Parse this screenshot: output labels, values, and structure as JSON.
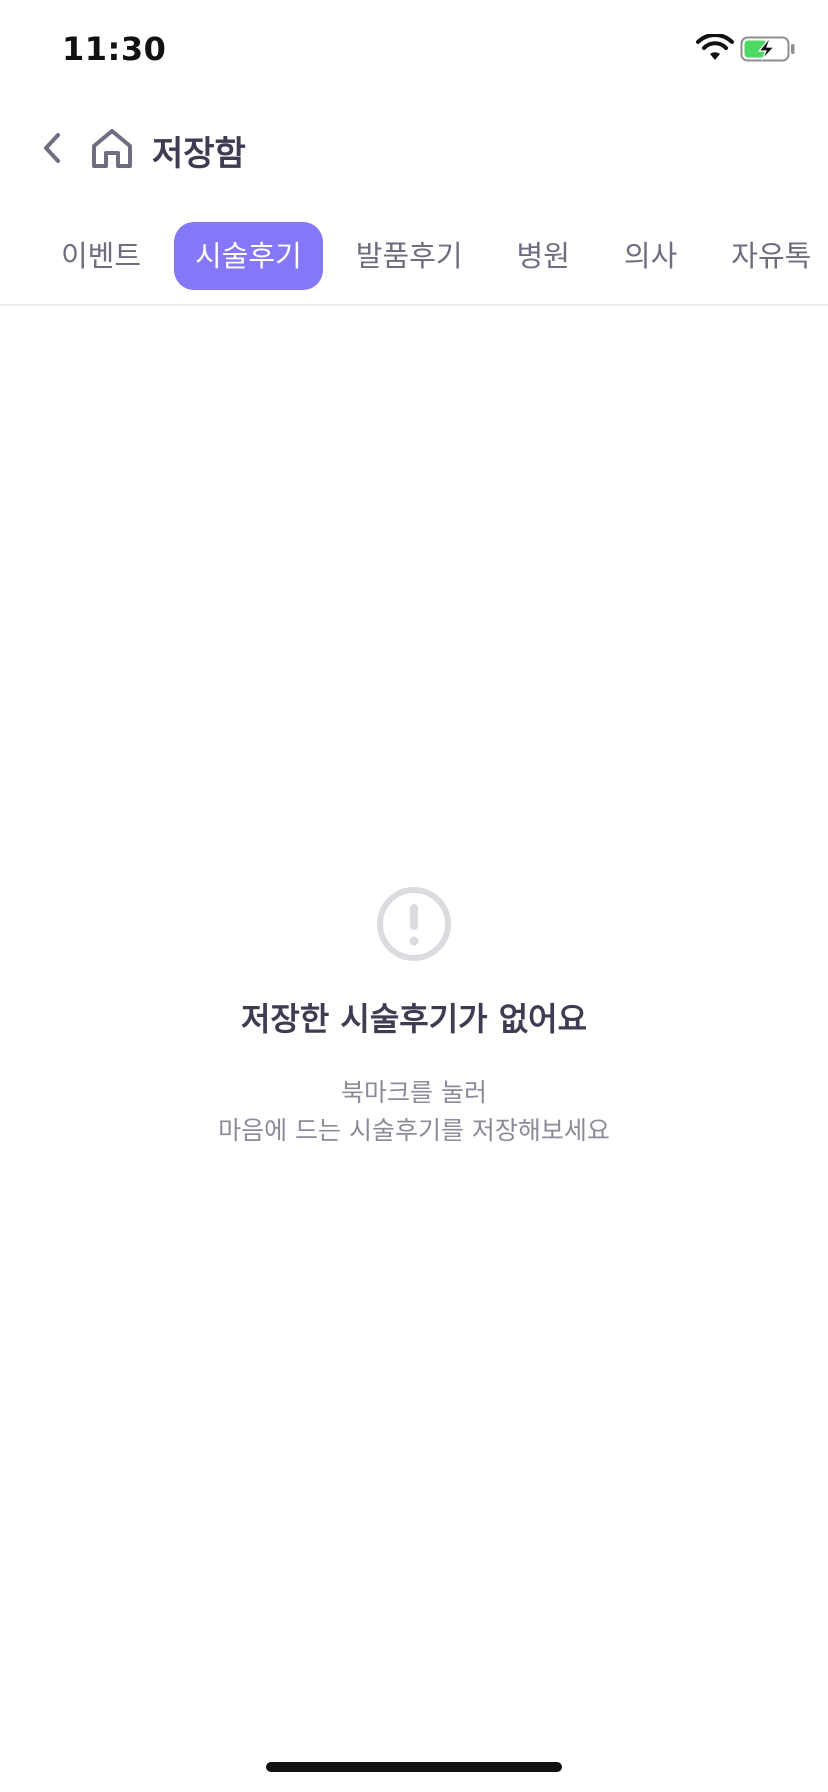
{
  "status_bar": {
    "time": "11:30",
    "icons": [
      "wifi-icon",
      "battery-charging-icon"
    ]
  },
  "header": {
    "title": "저장함",
    "icons": [
      "chevron-left-icon",
      "home-icon"
    ]
  },
  "tabs": [
    {
      "label": "이벤트",
      "active": false
    },
    {
      "label": "시술후기",
      "active": true
    },
    {
      "label": "발품후기",
      "active": false
    },
    {
      "label": "병원",
      "active": false
    },
    {
      "label": "의사",
      "active": false
    },
    {
      "label": "자유톡",
      "active": false
    }
  ],
  "empty_state": {
    "icon": "alert-circle-icon",
    "title": "저장한 시술후기가 없어요",
    "desc_line1": "북마크를 눌러",
    "desc_line2": "마음에 드는 시술후기를 저장해보세요"
  },
  "colors": {
    "accent": "#8478f8",
    "title_text": "#3d3c52",
    "muted_text": "#8d8b9a",
    "battery_green": "#4cd964"
  }
}
